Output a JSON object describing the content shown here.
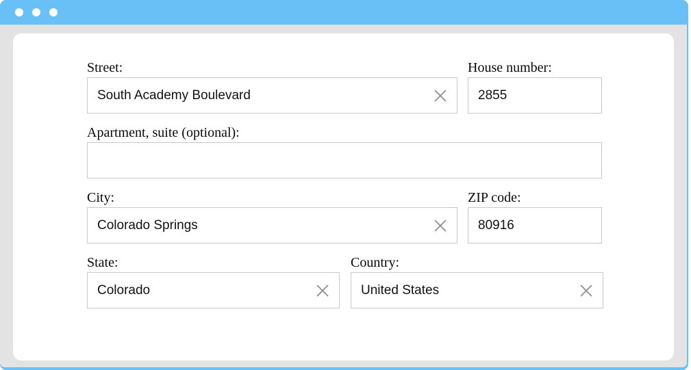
{
  "window": {
    "titlebar": {
      "dots": [
        "close-dot",
        "minimize-dot",
        "maximize-dot"
      ]
    },
    "colors": {
      "titlebar": "#68c0f7",
      "page_background": "#e3e3e3",
      "card_background": "#ffffff",
      "input_border": "#c9c9c9",
      "clear_icon": "#8d8d8d",
      "label_text": "#0a0a0a",
      "value_text": "#111111"
    }
  },
  "form": {
    "rows": [
      {
        "fields": [
          {
            "label": "Street:",
            "value": "South Academy Boulevard",
            "placeholder": "",
            "has_clear": true,
            "clear_icon": "close-x-icon"
          },
          {
            "label": "House number:",
            "value": "2855",
            "placeholder": "",
            "has_clear": false,
            "clear_icon": ""
          }
        ]
      },
      {
        "fields": [
          {
            "label": "Apartment, suite (optional):",
            "value": "",
            "placeholder": "",
            "has_clear": false,
            "clear_icon": ""
          }
        ]
      },
      {
        "fields": [
          {
            "label": "City:",
            "value": "Colorado Springs",
            "placeholder": "",
            "has_clear": true,
            "clear_icon": "close-x-icon"
          },
          {
            "label": "ZIP code:",
            "value": "80916",
            "placeholder": "",
            "has_clear": false,
            "clear_icon": ""
          }
        ]
      },
      {
        "fields": [
          {
            "label": "State:",
            "value": "Colorado",
            "placeholder": "",
            "has_clear": true,
            "clear_icon": "close-x-icon"
          },
          {
            "label": "Country:",
            "value": "United States",
            "placeholder": "",
            "has_clear": true,
            "clear_icon": "close-x-icon"
          }
        ]
      }
    ]
  }
}
